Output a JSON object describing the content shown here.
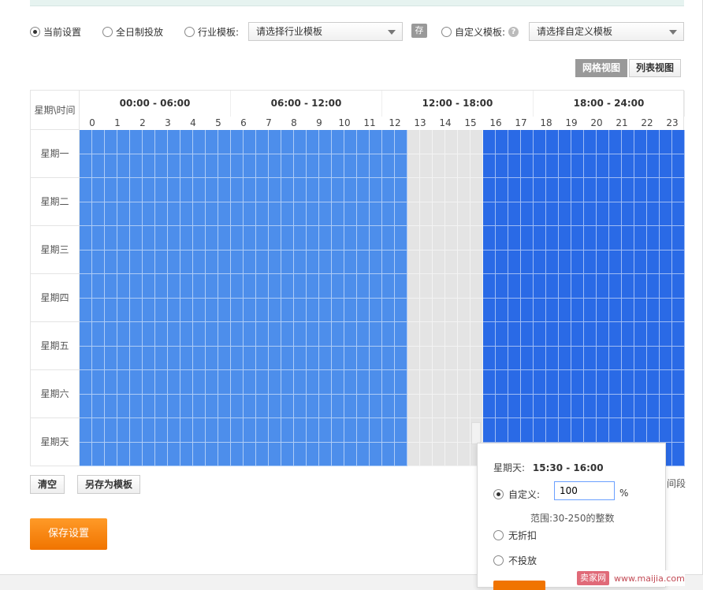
{
  "options": {
    "current": "当前设置",
    "all_day": "全日制投放",
    "industry_label": "行业模板:",
    "industry_placeholder": "请选择行业模板",
    "save_tag": "存",
    "custom_label": "自定义模板:",
    "custom_placeholder": "请选择自定义模板",
    "help": "?"
  },
  "view": {
    "grid": "网格视图",
    "list": "列表视图"
  },
  "grid": {
    "corner": "星期\\时间",
    "ranges": [
      "00:00 - 06:00",
      "06:00 - 12:00",
      "12:00 - 18:00",
      "18:00 - 24:00"
    ],
    "hours": [
      "0",
      "1",
      "2",
      "3",
      "4",
      "5",
      "6",
      "7",
      "8",
      "9",
      "10",
      "11",
      "12",
      "13",
      "14",
      "15",
      "16",
      "17",
      "18",
      "19",
      "20",
      "21",
      "22",
      "23"
    ],
    "days": [
      "星期一",
      "星期二",
      "星期三",
      "星期四",
      "星期五",
      "星期六",
      "星期天"
    ],
    "hour_state": [
      "on",
      "on",
      "on",
      "on",
      "on",
      "on",
      "on",
      "on",
      "on",
      "on",
      "on",
      "on",
      "on",
      "off",
      "off",
      "off",
      "full",
      "full",
      "full",
      "full",
      "full",
      "full",
      "full",
      "full"
    ]
  },
  "colors": {
    "on": "#4d8eeb",
    "off": "#e4e4e4",
    "full": "#2a6ae6",
    "primary": "#f07400"
  },
  "buttons": {
    "clear": "清空",
    "save_template": "另存为模板",
    "save_settings": "保存设置"
  },
  "hint_right": "间段",
  "popup": {
    "day": "星期天:",
    "time": "15:30 - 16:00",
    "custom_label": "自定义:",
    "custom_value": "100",
    "pct": "%",
    "range_hint": "范围:30-250的整数",
    "no_discount": "无折扣",
    "no_delivery": "不投放"
  },
  "watermark": {
    "logo": "卖家网",
    "url": "www.maijia.com"
  }
}
